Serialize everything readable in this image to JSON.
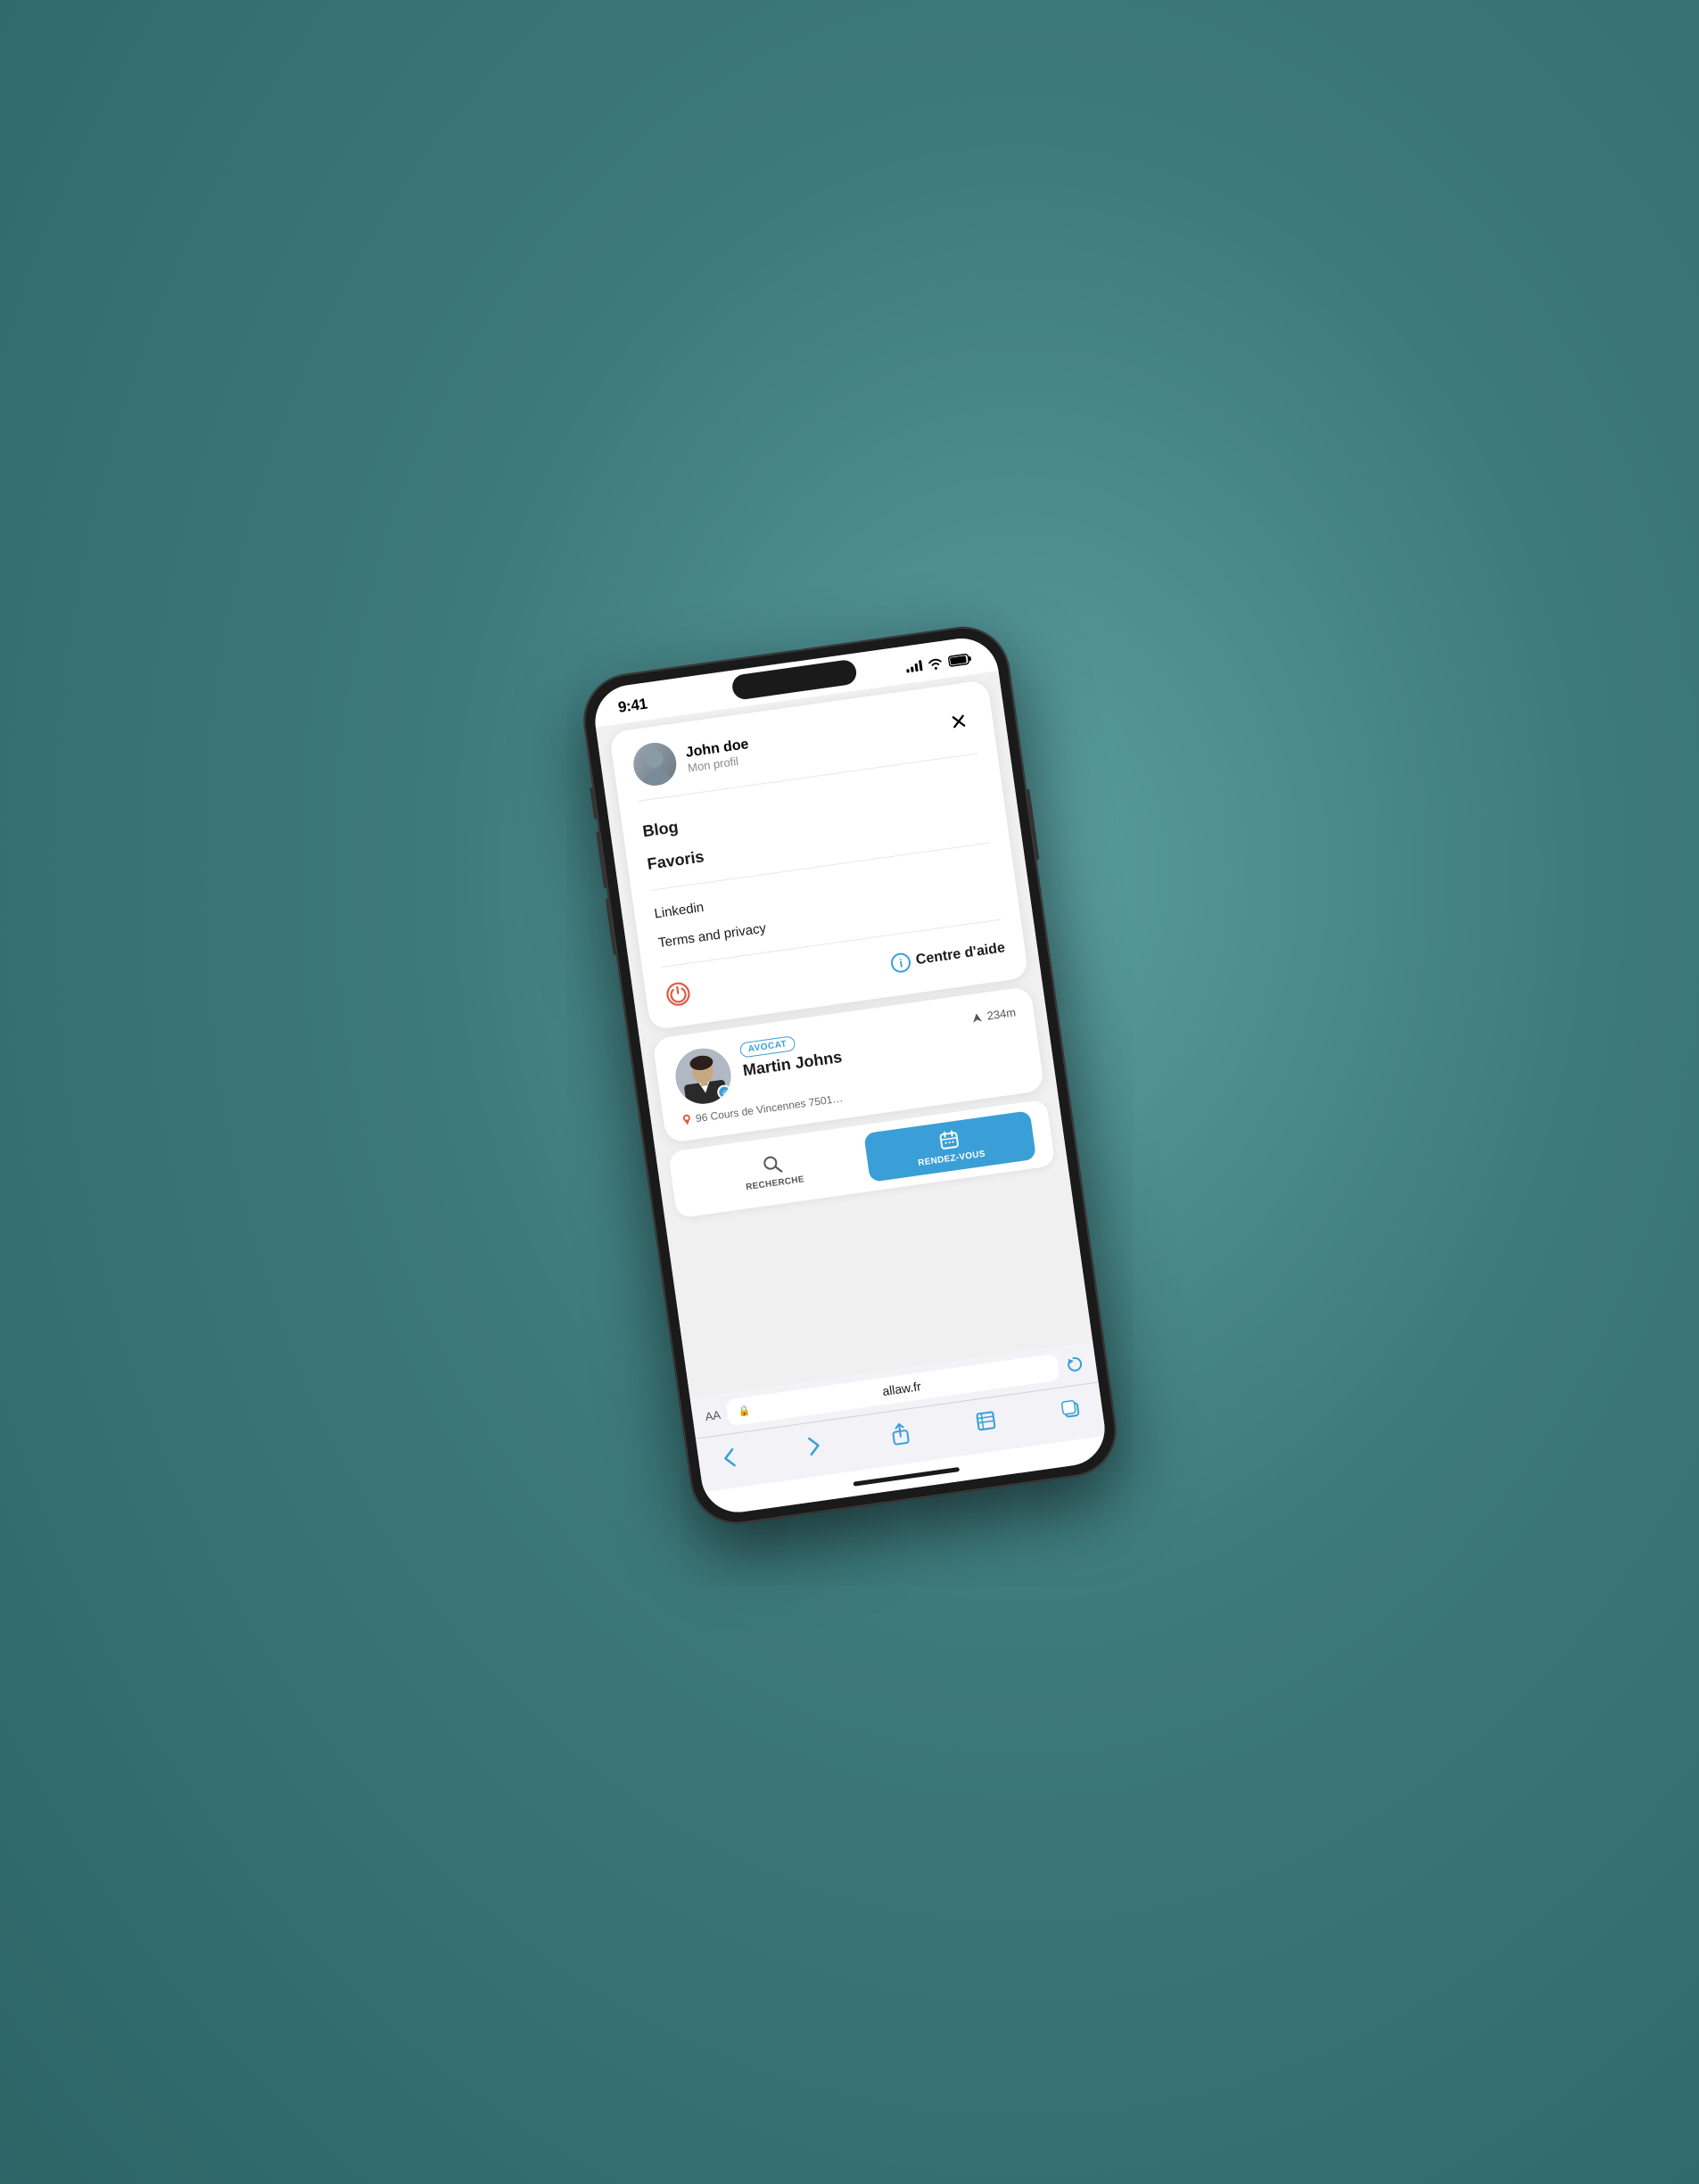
{
  "scene": {
    "background_color": "#4a8a8c"
  },
  "status_bar": {
    "time": "9:41",
    "signal_label": "signal",
    "wifi_label": "wifi",
    "battery_label": "battery"
  },
  "menu": {
    "profile": {
      "name": "John doe",
      "subtitle": "Mon profil"
    },
    "close_label": "×",
    "items": [
      {
        "label": "Blog",
        "type": "bold"
      },
      {
        "label": "Favoris",
        "type": "bold"
      },
      {
        "label": "Linkedin",
        "type": "light"
      },
      {
        "label": "Terms and privacy",
        "type": "light"
      }
    ],
    "logout_label": "logout",
    "help_label": "Centre d'aide"
  },
  "profile_card": {
    "badge": "AVOCAT",
    "distance": "234m",
    "name": "Martin Johns",
    "address": "96 Cours de Vincennes 7501…"
  },
  "tab_bar": {
    "tabs": [
      {
        "label": "RECHERCHE",
        "icon": "search",
        "active": false
      },
      {
        "label": "RENDEZ-VOUS",
        "icon": "calendar",
        "active": true
      }
    ]
  },
  "safari": {
    "aa_label": "AA",
    "lock_symbol": "🔒",
    "url": "allaw.fr",
    "refresh_symbol": "⟳"
  },
  "safari_toolbar": {
    "back_symbol": "‹",
    "forward_symbol": "›",
    "share_symbol": "share",
    "bookmarks_symbol": "bookmarks",
    "tabs_symbol": "tabs"
  }
}
